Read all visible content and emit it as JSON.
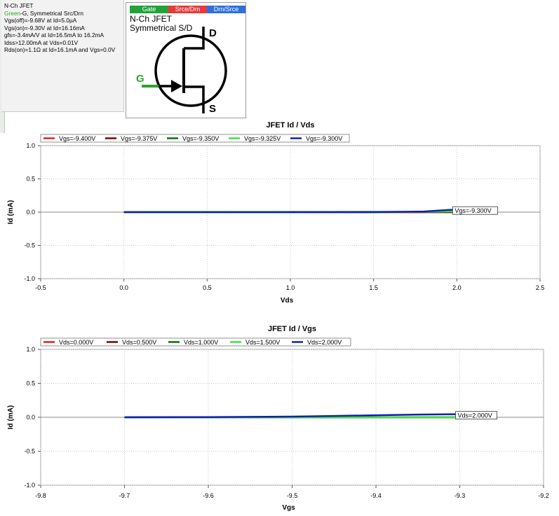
{
  "info": {
    "device": "N-Ch JFET",
    "pins_color_word": "Green",
    "pins_rest": "-G, Symmetrical Src/Drn",
    "lines": [
      "Vgs(off)=-9.68V at Id=5.0µA",
      "Vgs(on)=-9.30V at Id=16.16mA",
      "gfs=-3.4mA/V at Id=16.5mA to 16.2mA",
      "Idss>12.00mA at Vds=0.01V",
      "Rds(on)=1.1Ω at Id=16.1mA and Vgs=0.0V"
    ]
  },
  "symbol": {
    "tabs": [
      {
        "label": "Gate",
        "color": "#22a33a"
      },
      {
        "label": "Srce/Drn",
        "color": "#e83a3a"
      },
      {
        "label": "Drn/Srce",
        "color": "#2e6fe0"
      }
    ],
    "name": "N-Ch JFET",
    "description": "Symmetrical S/D",
    "pin_d": "D",
    "pin_s": "S",
    "pin_g": "G",
    "gate_color": "#2aa52a"
  },
  "chart_data": [
    {
      "type": "line",
      "title": "JFET Id / Vds",
      "xlabel": "Vds",
      "ylabel": "Id (mA)",
      "xlim": [
        -0.5,
        2.5
      ],
      "ylim": [
        -1.0,
        1.0
      ],
      "xticks": [
        "-0.5",
        "0.0",
        "0.5",
        "1.0",
        "1.5",
        "2.0",
        "2.5"
      ],
      "yticks": [
        "1.0",
        "0.5",
        "0.0",
        "-0.5",
        "-1.0"
      ],
      "grid": true,
      "legend_placement": "top-left",
      "series": [
        {
          "name": "Vgs=-9.400V",
          "color": "#e02020",
          "x": [
            0.0,
            2.0
          ],
          "y": [
            0.0,
            0.0
          ]
        },
        {
          "name": "Vgs=-9.375V",
          "color": "#7a0000",
          "x": [
            0.0,
            2.0
          ],
          "y": [
            0.0,
            0.0
          ]
        },
        {
          "name": "Vgs=-9.350V",
          "color": "#0a6e0a",
          "x": [
            0.0,
            2.0
          ],
          "y": [
            0.0,
            0.005
          ]
        },
        {
          "name": "Vgs=-9.325V",
          "color": "#40e040",
          "x": [
            0.0,
            1.6,
            2.0
          ],
          "y": [
            0.0,
            0.0,
            0.015
          ]
        },
        {
          "name": "Vgs=-9.300V",
          "color": "#1020b0",
          "x": [
            0.0,
            1.5,
            1.7,
            1.8,
            1.9,
            2.0
          ],
          "y": [
            0.0,
            0.0,
            0.005,
            0.01,
            0.025,
            0.04
          ]
        }
      ],
      "annotations": [
        {
          "text": "Vgs=-9.300V",
          "x": 2.0,
          "y": 0.04
        }
      ]
    },
    {
      "type": "line",
      "title": "JFET Id / Vgs",
      "xlabel": "Vgs",
      "ylabel": "Id (mA)",
      "xlim": [
        -9.8,
        -9.2
      ],
      "ylim": [
        -1.0,
        1.0
      ],
      "xticks": [
        "-9.8",
        "-9.7",
        "-9.6",
        "-9.5",
        "-9.4",
        "-9.3",
        "-9.2"
      ],
      "yticks": [
        "1.0",
        "0.5",
        "0.0",
        "-0.5",
        "-1.0"
      ],
      "grid": true,
      "legend_placement": "top-left",
      "series": [
        {
          "name": "Vds=0.000V",
          "color": "#e02020",
          "x": [
            -9.7,
            -9.69
          ],
          "y": [
            0.0,
            0.0
          ]
        },
        {
          "name": "Vds=0.500V",
          "color": "#7a0000",
          "x": [
            -9.7,
            -9.3
          ],
          "y": [
            0.0,
            0.0
          ]
        },
        {
          "name": "Vds=1.000V",
          "color": "#0a6e0a",
          "x": [
            -9.7,
            -9.3
          ],
          "y": [
            0.0,
            0.0
          ]
        },
        {
          "name": "Vds=1.500V",
          "color": "#40e040",
          "x": [
            -9.7,
            -9.3
          ],
          "y": [
            0.0,
            0.0
          ]
        },
        {
          "name": "Vds=2.000V",
          "color": "#1020b0",
          "x": [
            -9.7,
            -9.6,
            -9.5,
            -9.45,
            -9.4,
            -9.35,
            -9.3
          ],
          "y": [
            0.0,
            0.003,
            0.01,
            0.02,
            0.03,
            0.04,
            0.045
          ]
        }
      ],
      "annotations": [
        {
          "text": "Vds=2.000V",
          "x": -9.3,
          "y": 0.045
        }
      ]
    }
  ]
}
